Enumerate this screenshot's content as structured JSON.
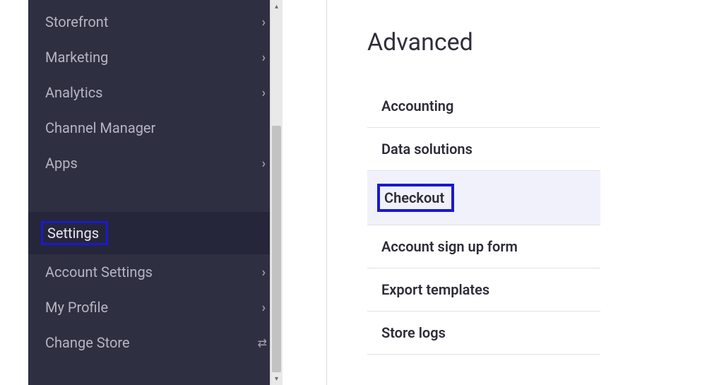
{
  "sidebar": {
    "items": [
      {
        "label": "Storefront",
        "chevron": true,
        "kind": "item"
      },
      {
        "label": "Marketing",
        "chevron": true,
        "kind": "item"
      },
      {
        "label": "Analytics",
        "chevron": true,
        "kind": "item"
      },
      {
        "label": "Channel Manager",
        "chevron": false,
        "kind": "item"
      },
      {
        "label": "Apps",
        "chevron": true,
        "kind": "item"
      },
      {
        "label": "",
        "chevron": false,
        "kind": "spacer"
      },
      {
        "label": "Settings",
        "chevron": false,
        "kind": "item",
        "active": true,
        "highlight": true
      },
      {
        "label": "Account Settings",
        "chevron": true,
        "kind": "item"
      },
      {
        "label": "My Profile",
        "chevron": true,
        "kind": "item"
      },
      {
        "label": "Change Store",
        "chevron": false,
        "kind": "item",
        "swap": true
      }
    ]
  },
  "main": {
    "title": "Advanced",
    "items": [
      {
        "label": "Accounting"
      },
      {
        "label": "Data solutions"
      },
      {
        "label": "Checkout",
        "selected": true,
        "highlight": true
      },
      {
        "label": "Account sign up form"
      },
      {
        "label": "Export templates"
      },
      {
        "label": "Store logs"
      }
    ]
  }
}
